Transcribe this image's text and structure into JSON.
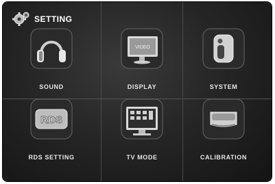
{
  "header": {
    "title": "SETTING",
    "icon": "gear-icon"
  },
  "tiles": [
    {
      "label": "SOUND",
      "icon": "headphones-icon"
    },
    {
      "label": "DISPLAY",
      "icon": "monitor-icon",
      "screen_text": "VIDEO"
    },
    {
      "label": "SYSTEM",
      "icon": "system-device-icon"
    },
    {
      "label": "RDS SETTING",
      "icon": "rds-icon",
      "icon_text": "RDS"
    },
    {
      "label": "TV MODE",
      "icon": "tv-icon"
    },
    {
      "label": "CALIBRATION",
      "icon": "calibration-device-icon"
    }
  ]
}
